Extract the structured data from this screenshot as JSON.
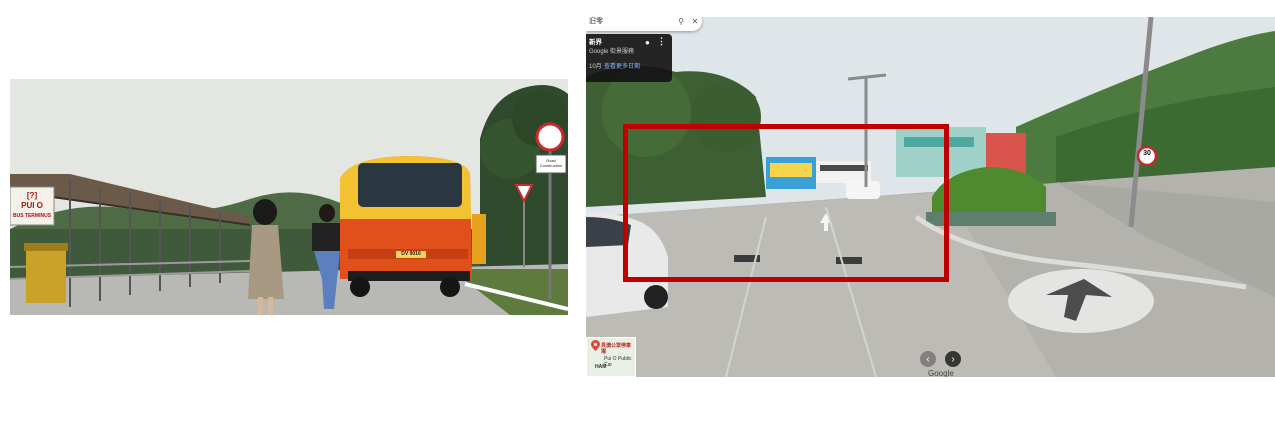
{
  "film": {
    "sign_left_lines": [
      "[?]",
      "PUI O",
      "BUS TERMINUS"
    ],
    "sign_pole_lines": [
      "Road Construction"
    ],
    "bus_plate": "DV 9016"
  },
  "street_view": {
    "search_query": "旧零",
    "card_title": "新界",
    "card_subtitle": "Google 街景服務",
    "card_date": "10月",
    "card_link": "查看更多日期",
    "minimap_label": "貝澳公眾停車場",
    "minimap_sub": "Pui O Public Car",
    "minimap_area": "HAM",
    "speed_limit": "30",
    "google_label": "Google"
  },
  "colors": {
    "highlight_box": "#c00000",
    "bus_orange": "#e14f1b",
    "bus_yellow": "#f2c230",
    "sky": "#dfe6e9"
  }
}
